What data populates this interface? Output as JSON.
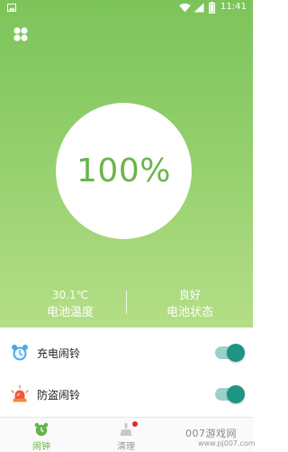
{
  "status_bar": {
    "time": "11:41",
    "icons": [
      "image-icon",
      "wifi-icon",
      "signal-icon",
      "battery-icon"
    ]
  },
  "top": {
    "menu_icon": "grid-menu-icon"
  },
  "battery": {
    "percent_text": "100%",
    "level": 1.0
  },
  "stats": {
    "temperature_value": "30.1℃",
    "temperature_label": "电池温度",
    "health_value": "良好",
    "health_label": "电池状态"
  },
  "settings": [
    {
      "icon": "alarm-clock-icon",
      "label": "充电闹铃",
      "enabled": true
    },
    {
      "icon": "siren-icon",
      "label": "防盗闹铃",
      "enabled": true
    }
  ],
  "tabs": [
    {
      "icon": "alarm-clock-icon",
      "label": "闹钟",
      "active": true
    },
    {
      "icon": "broom-icon",
      "label": "清理",
      "active": false,
      "badge": true
    }
  ],
  "watermark": {
    "text": "007游戏网",
    "url": "www.pj007.com"
  },
  "colors": {
    "hero_top": "#7cc45a",
    "hero_bottom": "#b4de86",
    "accent_green": "#66b34a",
    "toggle_on": "#1e9483",
    "badge": "#e02b2b"
  }
}
